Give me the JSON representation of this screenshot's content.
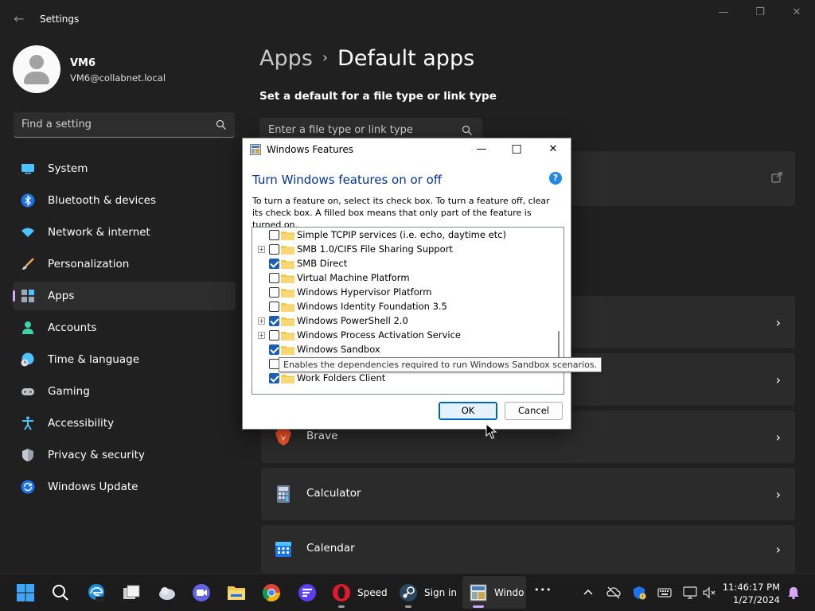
{
  "window": {
    "title": "Settings",
    "back_glyph": "←",
    "minimize_glyph": "—",
    "maximize_glyph": "❐",
    "close_glyph": "✕"
  },
  "profile": {
    "name": "VM6",
    "email": "VM6@collabnet.local"
  },
  "search": {
    "placeholder": "Find a setting"
  },
  "sidebar": {
    "items": [
      {
        "label": "System",
        "icon": "monitor-icon"
      },
      {
        "label": "Bluetooth & devices",
        "icon": "bluetooth-icon"
      },
      {
        "label": "Network & internet",
        "icon": "wifi-icon"
      },
      {
        "label": "Personalization",
        "icon": "brush-icon"
      },
      {
        "label": "Apps",
        "icon": "apps-icon"
      },
      {
        "label": "Accounts",
        "icon": "person-icon"
      },
      {
        "label": "Time & language",
        "icon": "globe-clock-icon"
      },
      {
        "label": "Gaming",
        "icon": "gamepad-icon"
      },
      {
        "label": "Accessibility",
        "icon": "accessibility-icon"
      },
      {
        "label": "Privacy & security",
        "icon": "shield-icon"
      },
      {
        "label": "Windows Update",
        "icon": "update-icon"
      }
    ]
  },
  "main": {
    "breadcrumb_parent": "Apps",
    "breadcrumb_separator": "›",
    "page_title": "Default apps",
    "section_title": "Set a default for a file type or link type",
    "type_input_placeholder": "Enter a file type or link type",
    "app_cards": [
      {
        "label": "Brave",
        "icon": "brave-icon"
      },
      {
        "label": "Calculator",
        "icon": "calculator-icon"
      },
      {
        "label": "Calendar",
        "icon": "calendar-icon"
      }
    ],
    "chevron_glyph": "›"
  },
  "dialog": {
    "title": "Windows Features",
    "heading": "Turn Windows features on or off",
    "help_glyph": "?",
    "description": "To turn a feature on, select its check box. To turn a feature off, clear its check box. A filled box means that only part of the feature is turned on.",
    "minimize_glyph": "—",
    "maximize_glyph": "☐",
    "close_glyph": "✕",
    "features": [
      {
        "label": "Simple TCPIP services (i.e. echo, daytime etc)",
        "checked": false,
        "expandable": false
      },
      {
        "label": "SMB 1.0/CIFS File Sharing Support",
        "checked": false,
        "expandable": true
      },
      {
        "label": "SMB Direct",
        "checked": true,
        "expandable": false
      },
      {
        "label": "Virtual Machine Platform",
        "checked": false,
        "expandable": false
      },
      {
        "label": "Windows Hypervisor Platform",
        "checked": false,
        "expandable": false
      },
      {
        "label": "Windows Identity Foundation 3.5",
        "checked": false,
        "expandable": false
      },
      {
        "label": "Windows PowerShell 2.0",
        "checked": true,
        "expandable": true
      },
      {
        "label": "Windows Process Activation Service",
        "checked": false,
        "expandable": true
      },
      {
        "label": "Windows Sandbox",
        "checked": true,
        "expandable": false
      },
      {
        "label": "",
        "checked": false,
        "expandable": false
      },
      {
        "label": "Work Folders Client",
        "checked": true,
        "expandable": false
      }
    ],
    "tooltip": "Enables the dependencies required to run Windows Sandbox scenarios.",
    "ok_label": "OK",
    "cancel_label": "Cancel",
    "expander_glyph": "+"
  },
  "taskbar": {
    "apps": [
      {
        "label": "Speed D",
        "icon": "opera-icon",
        "active": false
      },
      {
        "label": "Sign in t",
        "icon": "steam-icon",
        "active": false
      },
      {
        "label": "Windo",
        "icon": "windows-features-icon",
        "active": true
      }
    ],
    "more_glyph": "•••",
    "time": "11:46:17 PM",
    "date": "1/27/2024"
  },
  "colors": {
    "accent": "#d7a6ff",
    "dialog_heading": "#003399",
    "checkbox_checked": "#1a5fb4"
  }
}
